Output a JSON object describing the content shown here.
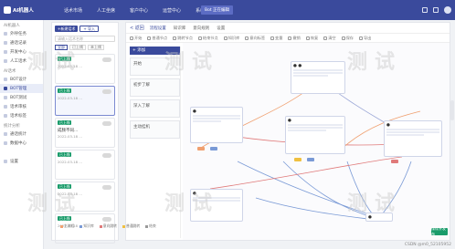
{
  "app": {
    "brand": "AI机器人",
    "nav": [
      "话术市场",
      "人工坐席",
      "客户中心",
      "运营中心",
      "系统设置"
    ],
    "status": "Bot 正在编辑"
  },
  "sidebar": {
    "sections": [
      {
        "title": "AI机器人",
        "items": [
          "外呼任务",
          "通话记录",
          "开发中心",
          "人工话术"
        ]
      },
      {
        "title": "AI话术",
        "items": [
          "BOT设计",
          "BOT管理",
          "BOT测试",
          "话术审核",
          "话术标签"
        ]
      },
      {
        "title": "统计分析",
        "items": [
          "通话统计",
          "数据中心"
        ]
      },
      {
        "title": "",
        "items": [
          "设置"
        ]
      }
    ],
    "active": "BOT管理"
  },
  "botlist": {
    "buttons": [
      "+新建话术",
      "+ 导入"
    ],
    "search_placeholder": "请输入话术名称",
    "filters": [
      "全部",
      "已上线",
      "未上线"
    ],
    "cards": [
      {
        "tag": "已上线",
        "name": "",
        "meta": "2022-03-18 ..."
      },
      {
        "tag": "已上线",
        "name": "",
        "meta": "2022-03-18 ..."
      },
      {
        "tag": "已上线",
        "name": "成频不同...",
        "meta": "2022-03-18 ..."
      },
      {
        "tag": "已上线",
        "name": "",
        "meta": "2022-03-18 ..."
      },
      {
        "tag": "已上线",
        "name": "",
        "meta": "2022-03-18 ..."
      },
      {
        "tag": "已上线",
        "name": "",
        "meta": "2022-03-18 ..."
      }
    ]
  },
  "editor": {
    "back": "< 返回",
    "tabs": [
      "流程设置",
      "知识库",
      "意向规则",
      "设置"
    ],
    "tools": [
      "开始",
      "普通节点",
      "跳转节点",
      "结束节点",
      "知识库",
      "意向标签",
      "变量",
      "撤销",
      "恢复",
      "清空",
      "保存",
      "导出"
    ],
    "nodes": [
      "开始",
      "初步了解",
      "深入了解",
      "主动挂机"
    ],
    "add_label": "+ 添加",
    "legend": [
      "主流程",
      "知识库",
      "意向跳转",
      "普通跳转",
      "结束"
    ],
    "save": "保存并发布"
  },
  "watermarks": [
    "测试",
    "测试",
    "测试",
    "测试",
    "测试",
    "测试"
  ],
  "credit": "CSDN @m0_52105952"
}
